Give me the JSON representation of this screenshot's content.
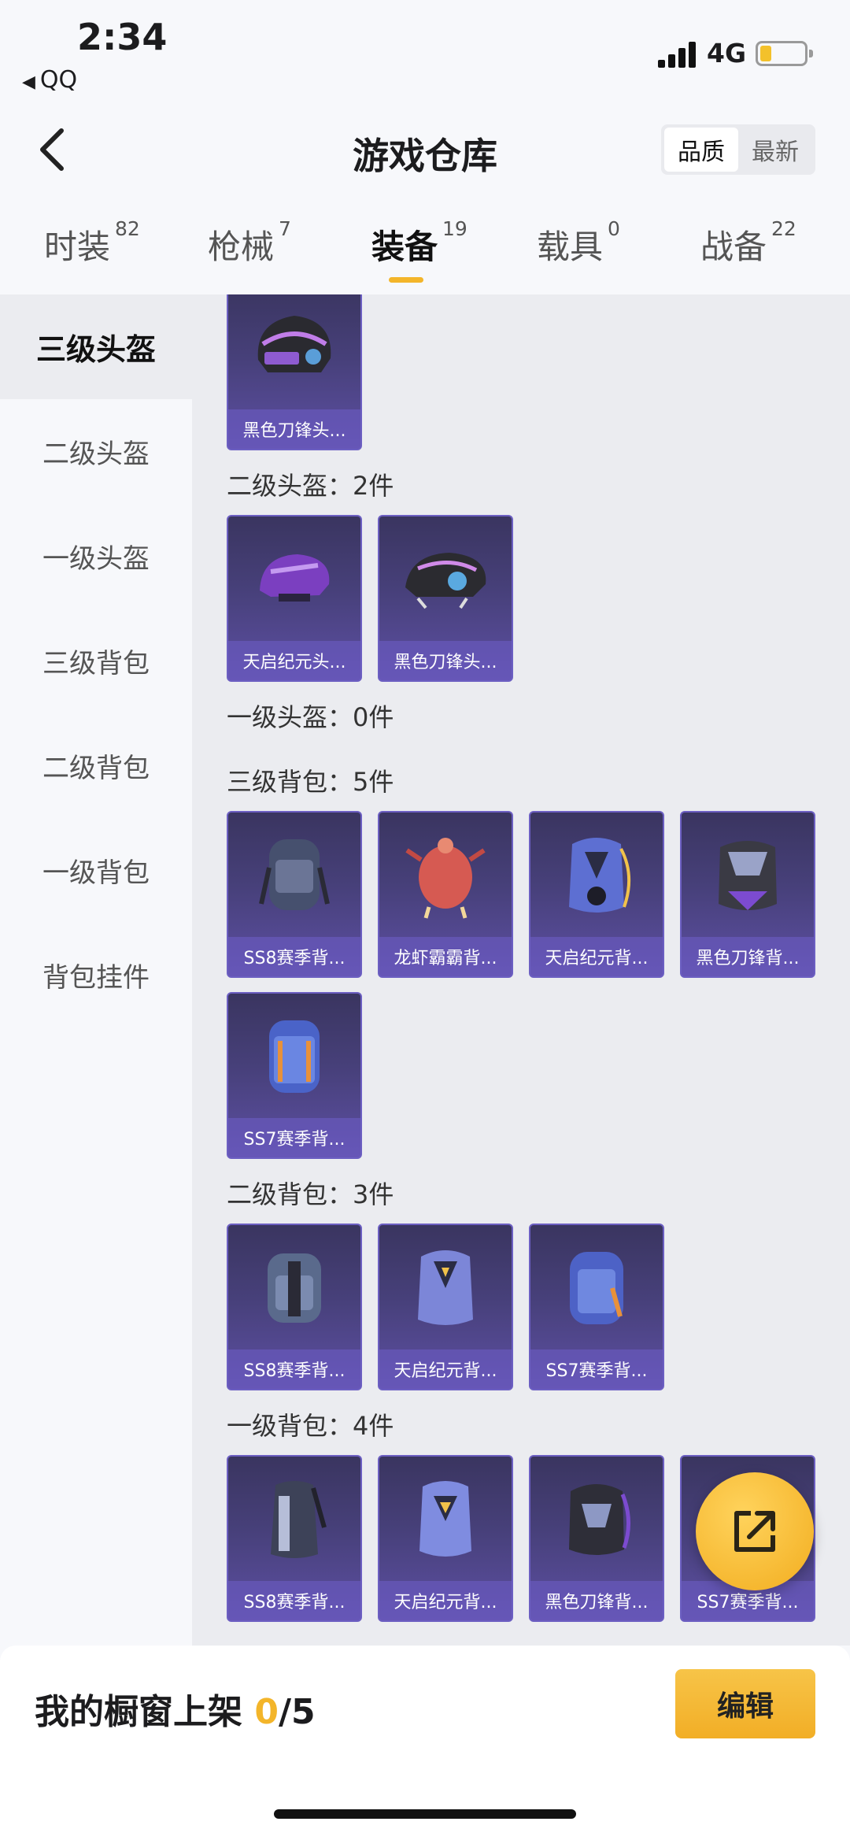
{
  "status": {
    "time": "2:34",
    "back_app": "QQ",
    "network": "4G"
  },
  "nav": {
    "title": "游戏仓库",
    "sort_options": [
      "品质",
      "最新"
    ],
    "sort_active": "品质"
  },
  "tabs": [
    {
      "label": "时装",
      "count": "82"
    },
    {
      "label": "枪械",
      "count": "7"
    },
    {
      "label": "装备",
      "count": "19",
      "active": true
    },
    {
      "label": "载具",
      "count": "0"
    },
    {
      "label": "战备",
      "count": "22"
    }
  ],
  "sidebar": {
    "items": [
      "三级头盔",
      "二级头盔",
      "一级头盔",
      "三级背包",
      "二级背包",
      "一级背包",
      "背包挂件"
    ],
    "active": "三级头盔"
  },
  "sections": [
    {
      "title": "",
      "items": [
        "黑色刀锋头..."
      ]
    },
    {
      "title": "二级头盔：2件",
      "items": [
        "天启纪元头...",
        "黑色刀锋头..."
      ]
    },
    {
      "title": "一级头盔：0件",
      "items": []
    },
    {
      "title": "三级背包：5件",
      "items": [
        "SS8赛季背...",
        "龙虾霸霸背...",
        "天启纪元背...",
        "黑色刀锋背...",
        "SS7赛季背..."
      ]
    },
    {
      "title": "二级背包：3件",
      "items": [
        "SS8赛季背...",
        "天启纪元背...",
        "SS7赛季背..."
      ]
    },
    {
      "title": "一级背包：4件",
      "items": [
        "SS8赛季背...",
        "天启纪元背...",
        "黑色刀锋背...",
        "SS7赛季背..."
      ]
    }
  ],
  "shelf": {
    "prefix": "我的橱窗上架 ",
    "current": "0",
    "total": "/5",
    "edit_label": "编辑"
  },
  "colors": {
    "accent": "#f3b52a",
    "card": "#4a4280"
  }
}
